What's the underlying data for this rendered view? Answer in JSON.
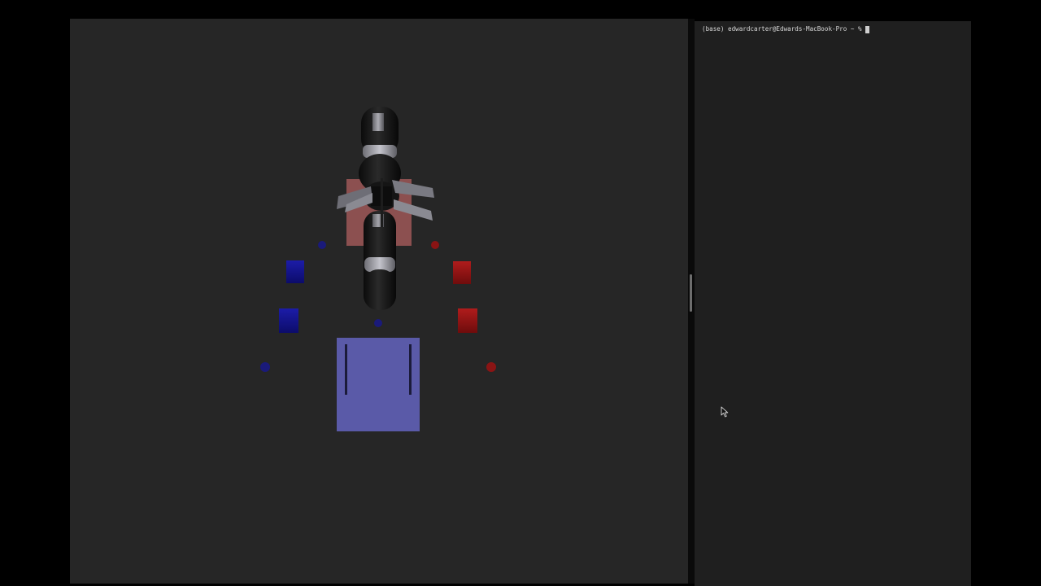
{
  "terminal": {
    "prompt": "(base) edwardcarter@Edwards-MacBook-Pro ~ %",
    "input": ""
  },
  "scene": {
    "background_color": "#262626",
    "blue_cube_color": "#14148a",
    "red_cube_color": "#8c1414",
    "target_pad_blue_color": "#5a5aa8",
    "target_pad_red_color": "#8c5050",
    "robot_color": "#111111",
    "gripper_color": "#7a7a82"
  },
  "colors": {
    "desktop": "#000000",
    "terminal_background": "#1f1f1f",
    "terminal_text": "#d6d6d6"
  }
}
